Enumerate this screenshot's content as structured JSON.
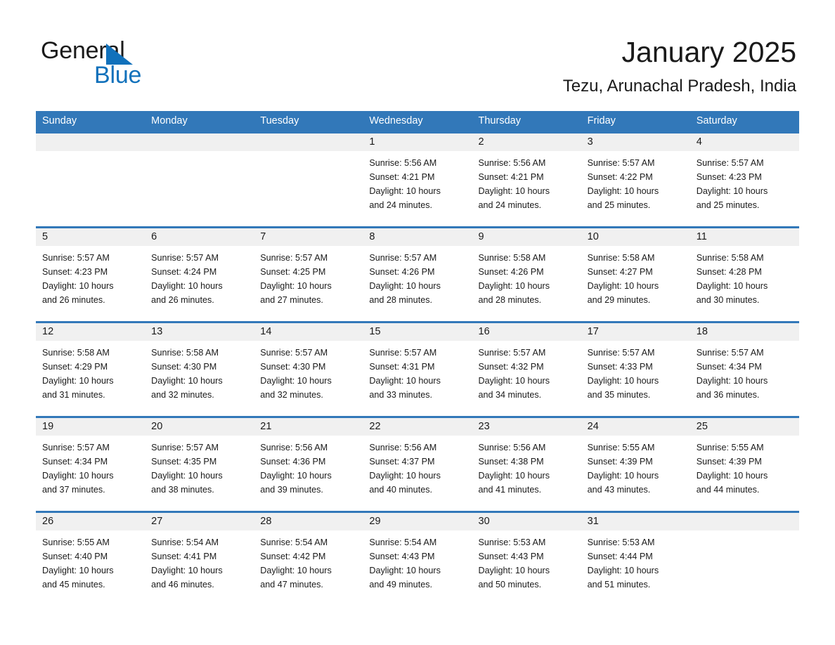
{
  "brand": {
    "name_part1": "General",
    "name_part2": "Blue",
    "accent_color": "#1171bb",
    "triangle_icon": "triangle-icon"
  },
  "header": {
    "month_title": "January 2025",
    "location": "Tezu, Arunachal Pradesh, India"
  },
  "theme": {
    "header_blue": "#3278b9",
    "date_band_gray": "#f0f0f0",
    "text_color": "#1a1a1a"
  },
  "weekdays": [
    "Sunday",
    "Monday",
    "Tuesday",
    "Wednesday",
    "Thursday",
    "Friday",
    "Saturday"
  ],
  "weeks": [
    {
      "days": [
        {
          "date": "",
          "sunrise": "",
          "sunset": "",
          "daylight_line1": "",
          "daylight_line2": "",
          "empty": true
        },
        {
          "date": "",
          "sunrise": "",
          "sunset": "",
          "daylight_line1": "",
          "daylight_line2": "",
          "empty": true
        },
        {
          "date": "",
          "sunrise": "",
          "sunset": "",
          "daylight_line1": "",
          "daylight_line2": "",
          "empty": true
        },
        {
          "date": "1",
          "sunrise": "Sunrise: 5:56 AM",
          "sunset": "Sunset: 4:21 PM",
          "daylight_line1": "Daylight: 10 hours",
          "daylight_line2": "and 24 minutes.",
          "empty": false
        },
        {
          "date": "2",
          "sunrise": "Sunrise: 5:56 AM",
          "sunset": "Sunset: 4:21 PM",
          "daylight_line1": "Daylight: 10 hours",
          "daylight_line2": "and 24 minutes.",
          "empty": false
        },
        {
          "date": "3",
          "sunrise": "Sunrise: 5:57 AM",
          "sunset": "Sunset: 4:22 PM",
          "daylight_line1": "Daylight: 10 hours",
          "daylight_line2": "and 25 minutes.",
          "empty": false
        },
        {
          "date": "4",
          "sunrise": "Sunrise: 5:57 AM",
          "sunset": "Sunset: 4:23 PM",
          "daylight_line1": "Daylight: 10 hours",
          "daylight_line2": "and 25 minutes.",
          "empty": false
        }
      ]
    },
    {
      "days": [
        {
          "date": "5",
          "sunrise": "Sunrise: 5:57 AM",
          "sunset": "Sunset: 4:23 PM",
          "daylight_line1": "Daylight: 10 hours",
          "daylight_line2": "and 26 minutes.",
          "empty": false
        },
        {
          "date": "6",
          "sunrise": "Sunrise: 5:57 AM",
          "sunset": "Sunset: 4:24 PM",
          "daylight_line1": "Daylight: 10 hours",
          "daylight_line2": "and 26 minutes.",
          "empty": false
        },
        {
          "date": "7",
          "sunrise": "Sunrise: 5:57 AM",
          "sunset": "Sunset: 4:25 PM",
          "daylight_line1": "Daylight: 10 hours",
          "daylight_line2": "and 27 minutes.",
          "empty": false
        },
        {
          "date": "8",
          "sunrise": "Sunrise: 5:57 AM",
          "sunset": "Sunset: 4:26 PM",
          "daylight_line1": "Daylight: 10 hours",
          "daylight_line2": "and 28 minutes.",
          "empty": false
        },
        {
          "date": "9",
          "sunrise": "Sunrise: 5:58 AM",
          "sunset": "Sunset: 4:26 PM",
          "daylight_line1": "Daylight: 10 hours",
          "daylight_line2": "and 28 minutes.",
          "empty": false
        },
        {
          "date": "10",
          "sunrise": "Sunrise: 5:58 AM",
          "sunset": "Sunset: 4:27 PM",
          "daylight_line1": "Daylight: 10 hours",
          "daylight_line2": "and 29 minutes.",
          "empty": false
        },
        {
          "date": "11",
          "sunrise": "Sunrise: 5:58 AM",
          "sunset": "Sunset: 4:28 PM",
          "daylight_line1": "Daylight: 10 hours",
          "daylight_line2": "and 30 minutes.",
          "empty": false
        }
      ]
    },
    {
      "days": [
        {
          "date": "12",
          "sunrise": "Sunrise: 5:58 AM",
          "sunset": "Sunset: 4:29 PM",
          "daylight_line1": "Daylight: 10 hours",
          "daylight_line2": "and 31 minutes.",
          "empty": false
        },
        {
          "date": "13",
          "sunrise": "Sunrise: 5:58 AM",
          "sunset": "Sunset: 4:30 PM",
          "daylight_line1": "Daylight: 10 hours",
          "daylight_line2": "and 32 minutes.",
          "empty": false
        },
        {
          "date": "14",
          "sunrise": "Sunrise: 5:57 AM",
          "sunset": "Sunset: 4:30 PM",
          "daylight_line1": "Daylight: 10 hours",
          "daylight_line2": "and 32 minutes.",
          "empty": false
        },
        {
          "date": "15",
          "sunrise": "Sunrise: 5:57 AM",
          "sunset": "Sunset: 4:31 PM",
          "daylight_line1": "Daylight: 10 hours",
          "daylight_line2": "and 33 minutes.",
          "empty": false
        },
        {
          "date": "16",
          "sunrise": "Sunrise: 5:57 AM",
          "sunset": "Sunset: 4:32 PM",
          "daylight_line1": "Daylight: 10 hours",
          "daylight_line2": "and 34 minutes.",
          "empty": false
        },
        {
          "date": "17",
          "sunrise": "Sunrise: 5:57 AM",
          "sunset": "Sunset: 4:33 PM",
          "daylight_line1": "Daylight: 10 hours",
          "daylight_line2": "and 35 minutes.",
          "empty": false
        },
        {
          "date": "18",
          "sunrise": "Sunrise: 5:57 AM",
          "sunset": "Sunset: 4:34 PM",
          "daylight_line1": "Daylight: 10 hours",
          "daylight_line2": "and 36 minutes.",
          "empty": false
        }
      ]
    },
    {
      "days": [
        {
          "date": "19",
          "sunrise": "Sunrise: 5:57 AM",
          "sunset": "Sunset: 4:34 PM",
          "daylight_line1": "Daylight: 10 hours",
          "daylight_line2": "and 37 minutes.",
          "empty": false
        },
        {
          "date": "20",
          "sunrise": "Sunrise: 5:57 AM",
          "sunset": "Sunset: 4:35 PM",
          "daylight_line1": "Daylight: 10 hours",
          "daylight_line2": "and 38 minutes.",
          "empty": false
        },
        {
          "date": "21",
          "sunrise": "Sunrise: 5:56 AM",
          "sunset": "Sunset: 4:36 PM",
          "daylight_line1": "Daylight: 10 hours",
          "daylight_line2": "and 39 minutes.",
          "empty": false
        },
        {
          "date": "22",
          "sunrise": "Sunrise: 5:56 AM",
          "sunset": "Sunset: 4:37 PM",
          "daylight_line1": "Daylight: 10 hours",
          "daylight_line2": "and 40 minutes.",
          "empty": false
        },
        {
          "date": "23",
          "sunrise": "Sunrise: 5:56 AM",
          "sunset": "Sunset: 4:38 PM",
          "daylight_line1": "Daylight: 10 hours",
          "daylight_line2": "and 41 minutes.",
          "empty": false
        },
        {
          "date": "24",
          "sunrise": "Sunrise: 5:55 AM",
          "sunset": "Sunset: 4:39 PM",
          "daylight_line1": "Daylight: 10 hours",
          "daylight_line2": "and 43 minutes.",
          "empty": false
        },
        {
          "date": "25",
          "sunrise": "Sunrise: 5:55 AM",
          "sunset": "Sunset: 4:39 PM",
          "daylight_line1": "Daylight: 10 hours",
          "daylight_line2": "and 44 minutes.",
          "empty": false
        }
      ]
    },
    {
      "days": [
        {
          "date": "26",
          "sunrise": "Sunrise: 5:55 AM",
          "sunset": "Sunset: 4:40 PM",
          "daylight_line1": "Daylight: 10 hours",
          "daylight_line2": "and 45 minutes.",
          "empty": false
        },
        {
          "date": "27",
          "sunrise": "Sunrise: 5:54 AM",
          "sunset": "Sunset: 4:41 PM",
          "daylight_line1": "Daylight: 10 hours",
          "daylight_line2": "and 46 minutes.",
          "empty": false
        },
        {
          "date": "28",
          "sunrise": "Sunrise: 5:54 AM",
          "sunset": "Sunset: 4:42 PM",
          "daylight_line1": "Daylight: 10 hours",
          "daylight_line2": "and 47 minutes.",
          "empty": false
        },
        {
          "date": "29",
          "sunrise": "Sunrise: 5:54 AM",
          "sunset": "Sunset: 4:43 PM",
          "daylight_line1": "Daylight: 10 hours",
          "daylight_line2": "and 49 minutes.",
          "empty": false
        },
        {
          "date": "30",
          "sunrise": "Sunrise: 5:53 AM",
          "sunset": "Sunset: 4:43 PM",
          "daylight_line1": "Daylight: 10 hours",
          "daylight_line2": "and 50 minutes.",
          "empty": false
        },
        {
          "date": "31",
          "sunrise": "Sunrise: 5:53 AM",
          "sunset": "Sunset: 4:44 PM",
          "daylight_line1": "Daylight: 10 hours",
          "daylight_line2": "and 51 minutes.",
          "empty": false
        },
        {
          "date": "",
          "sunrise": "",
          "sunset": "",
          "daylight_line1": "",
          "daylight_line2": "",
          "empty": true
        }
      ]
    }
  ]
}
